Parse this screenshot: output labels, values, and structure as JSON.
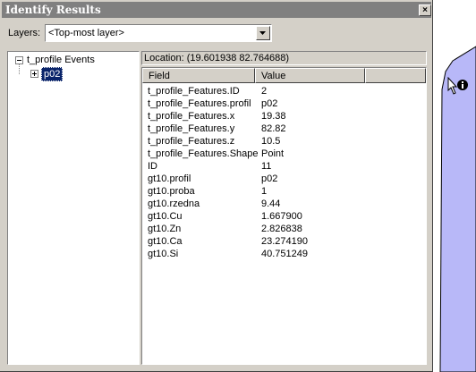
{
  "window": {
    "title": "Identify Results",
    "close_glyph": "×"
  },
  "layers": {
    "label": "Layers:",
    "value": "<Top-most layer>"
  },
  "tree": {
    "root_label": "t_profile Events",
    "child_label": "p02"
  },
  "location": "Location: (19.601938 82.764688)",
  "table": {
    "headers": {
      "field": "Field",
      "value": "Value"
    },
    "rows": [
      {
        "field": "t_profile_Features.ID",
        "value": "2"
      },
      {
        "field": "t_profile_Features.profil",
        "value": "p02"
      },
      {
        "field": "t_profile_Features.x",
        "value": "19.38"
      },
      {
        "field": "t_profile_Features.y",
        "value": "82.82"
      },
      {
        "field": "t_profile_Features.z",
        "value": "10.5"
      },
      {
        "field": "t_profile_Features.Shape",
        "value": "Point"
      },
      {
        "field": "ID",
        "value": "11"
      },
      {
        "field": "gt10.profil",
        "value": "p02"
      },
      {
        "field": "gt10.proba",
        "value": "1"
      },
      {
        "field": "gt10.rzedna",
        "value": "9.44"
      },
      {
        "field": "gt10.Cu",
        "value": "1.667900"
      },
      {
        "field": "gt10.Zn",
        "value": "2.826838"
      },
      {
        "field": "gt10.Ca",
        "value": "23.274190"
      },
      {
        "field": "gt10.Si",
        "value": "40.751249"
      }
    ]
  },
  "colors": {
    "title_bar": "#808080",
    "selection": "#0a246a",
    "map_polygon": "#b8b8f8",
    "window_face": "#d4d0c8"
  },
  "icons": {
    "cursor": "identify-cursor-icon",
    "close": "close-icon",
    "dropdown": "chevron-down-icon"
  }
}
